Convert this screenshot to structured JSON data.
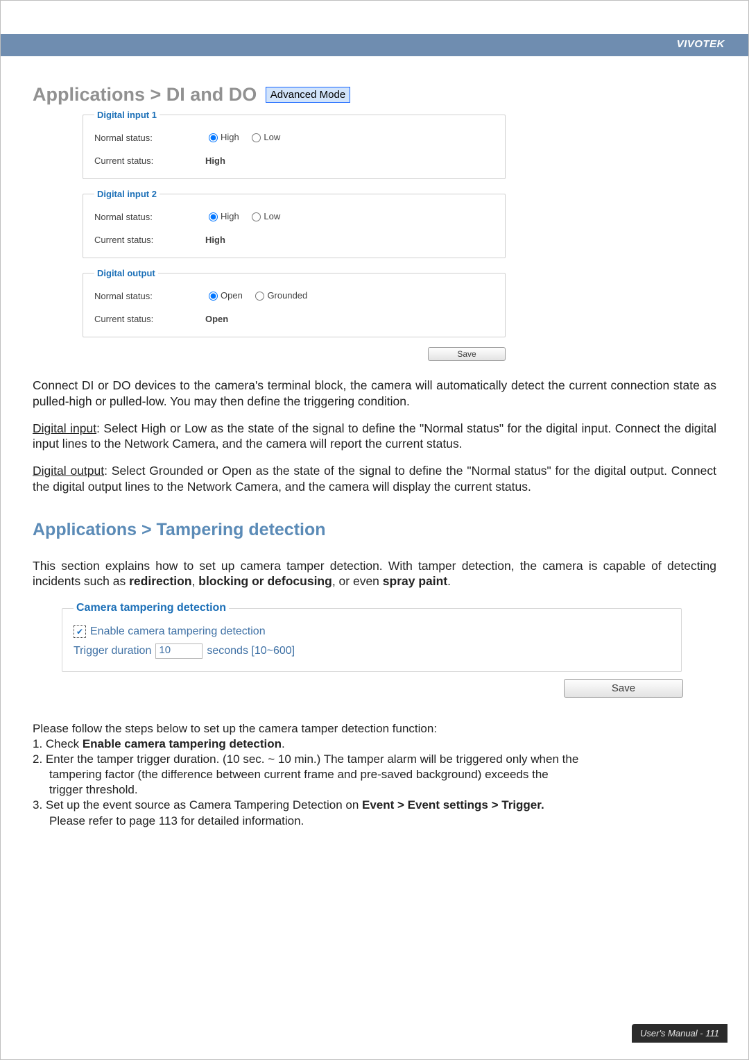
{
  "brand": "VIVOTEK",
  "heading_dido": "Applications > DI and DO",
  "mode_badge": "Advanced Mode",
  "di1": {
    "legend": "Digital input 1",
    "normal_label": "Normal status:",
    "high": "High",
    "low": "Low",
    "current_label": "Current status:",
    "current_value": "High"
  },
  "di2": {
    "legend": "Digital input 2",
    "normal_label": "Normal status:",
    "high": "High",
    "low": "Low",
    "current_label": "Current status:",
    "current_value": "High"
  },
  "do": {
    "legend": "Digital output",
    "normal_label": "Normal status:",
    "open": "Open",
    "grounded": "Grounded",
    "current_label": "Current status:",
    "current_value": "Open"
  },
  "save_label": "Save",
  "para_intro": "Connect DI or DO devices to the camera's terminal block, the camera will automatically detect the current connection state as pulled-high or pulled-low. You may then define the triggering condition.",
  "di_label_u": "Digital input",
  "para_di": ": Select High or Low as the state of the signal to define the \"Normal status\" for the digital input. Connect the digital input lines to the Network Camera, and the camera will report the current status.",
  "do_label_u": "Digital output",
  "para_do": ": Select Grounded or Open as the state of the signal to define the \"Normal status\" for the digital output. Connect the digital output lines to the Network Camera, and the camera will display the current status.",
  "heading_tamper": "Applications > Tampering detection",
  "tamper_intro_1": "This section explains how to set up camera tamper detection. With tamper detection, the camera is capable of detecting incidents such as ",
  "tamper_bold1": "redirection",
  "tamper_sep1": ", ",
  "tamper_bold2": "blocking or defocusing",
  "tamper_sep2": ", or even ",
  "tamper_bold3": "spray paint",
  "tamper_end": ".",
  "tamper_panel": {
    "legend": "Camera tampering detection",
    "enable": "Enable camera tampering detection",
    "trigger_label": "Trigger duration",
    "trigger_value": "10",
    "trigger_unit": "seconds [10~600]"
  },
  "steps_intro": "Please follow the steps below to set up the camera tamper detection function:",
  "step1_a": "1. Check ",
  "step1_b": "Enable camera tampering detection",
  "step1_c": ".",
  "step2_a": "2. Enter the tamper trigger duration. (10 sec. ~ 10 min.) The tamper alarm will be triggered only when the",
  "step2_b": "tampering factor (the difference between current frame and pre-saved background) exceeds the",
  "step2_c": "trigger threshold.",
  "step3_a": "3. Set up the event source as Camera Tampering Detection on ",
  "step3_b": "Event > Event settings > Trigger.",
  "step3_c": "Please refer to page 113 for detailed information.",
  "footer": "User's Manual - 111"
}
